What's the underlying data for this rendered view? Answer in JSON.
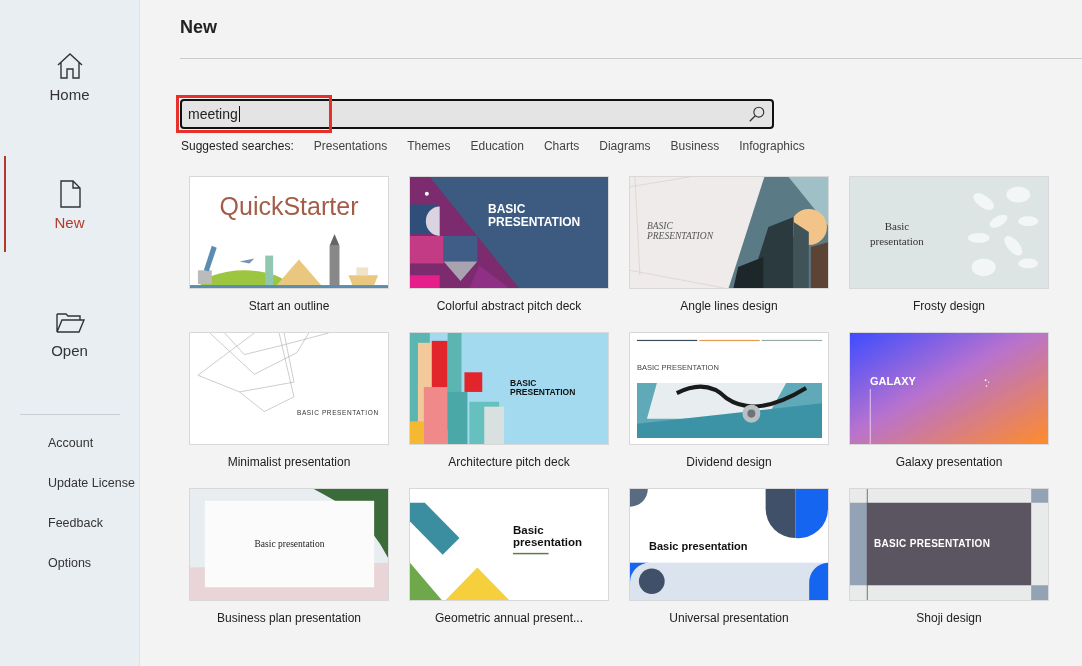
{
  "sidebar": {
    "top_items": [
      {
        "label": "Home",
        "kind": "home",
        "selected": false
      },
      {
        "label": "New",
        "kind": "new",
        "selected": true
      },
      {
        "label": "Open",
        "kind": "open",
        "selected": false
      }
    ],
    "bottom_items": [
      "Account",
      "Update License",
      "Feedback",
      "Options"
    ]
  },
  "page_title": "New",
  "search": {
    "value": "meeting",
    "highlighted": true
  },
  "suggested": {
    "label": "Suggested searches:",
    "links": [
      "Presentations",
      "Themes",
      "Education",
      "Charts",
      "Diagrams",
      "Business",
      "Infographics"
    ]
  },
  "templates": [
    {
      "title": "Start an outline",
      "kind": "quickstarter",
      "slide_lines": [
        "QuickStarter"
      ]
    },
    {
      "title": "Colorful abstract pitch deck",
      "kind": "colorful",
      "slide_lines": [
        "BASIC",
        "PRESENTATION"
      ]
    },
    {
      "title": "Angle lines design",
      "kind": "angle",
      "slide_lines": [
        "BASIC",
        "PRESENTATION"
      ]
    },
    {
      "title": "Frosty design",
      "kind": "frosty",
      "slide_lines": [
        "Basic",
        "presentation"
      ]
    },
    {
      "title": "Minimalist presentation",
      "kind": "minimalist",
      "slide_lines": [
        "BASIC PRESENTATION"
      ]
    },
    {
      "title": "Architecture pitch deck",
      "kind": "architecture",
      "slide_lines": [
        "BASIC",
        "PRESENTATION"
      ]
    },
    {
      "title": "Dividend design",
      "kind": "dividend",
      "slide_lines": [
        "BASIC PRESENTATION"
      ]
    },
    {
      "title": "Galaxy presentation",
      "kind": "galaxy",
      "slide_lines": [
        "GALAXY"
      ]
    },
    {
      "title": "Business plan presentation",
      "kind": "business",
      "slide_lines": [
        "Basic presentation"
      ]
    },
    {
      "title": "Geometric annual present...",
      "kind": "geometric",
      "slide_lines": [
        "Basic",
        "presentation"
      ]
    },
    {
      "title": "Universal presentation",
      "kind": "universal",
      "slide_lines": [
        "Basic presentation"
      ]
    },
    {
      "title": "Shoji design",
      "kind": "shoji",
      "slide_lines": [
        "BASIC PRESENTATION"
      ]
    }
  ]
}
